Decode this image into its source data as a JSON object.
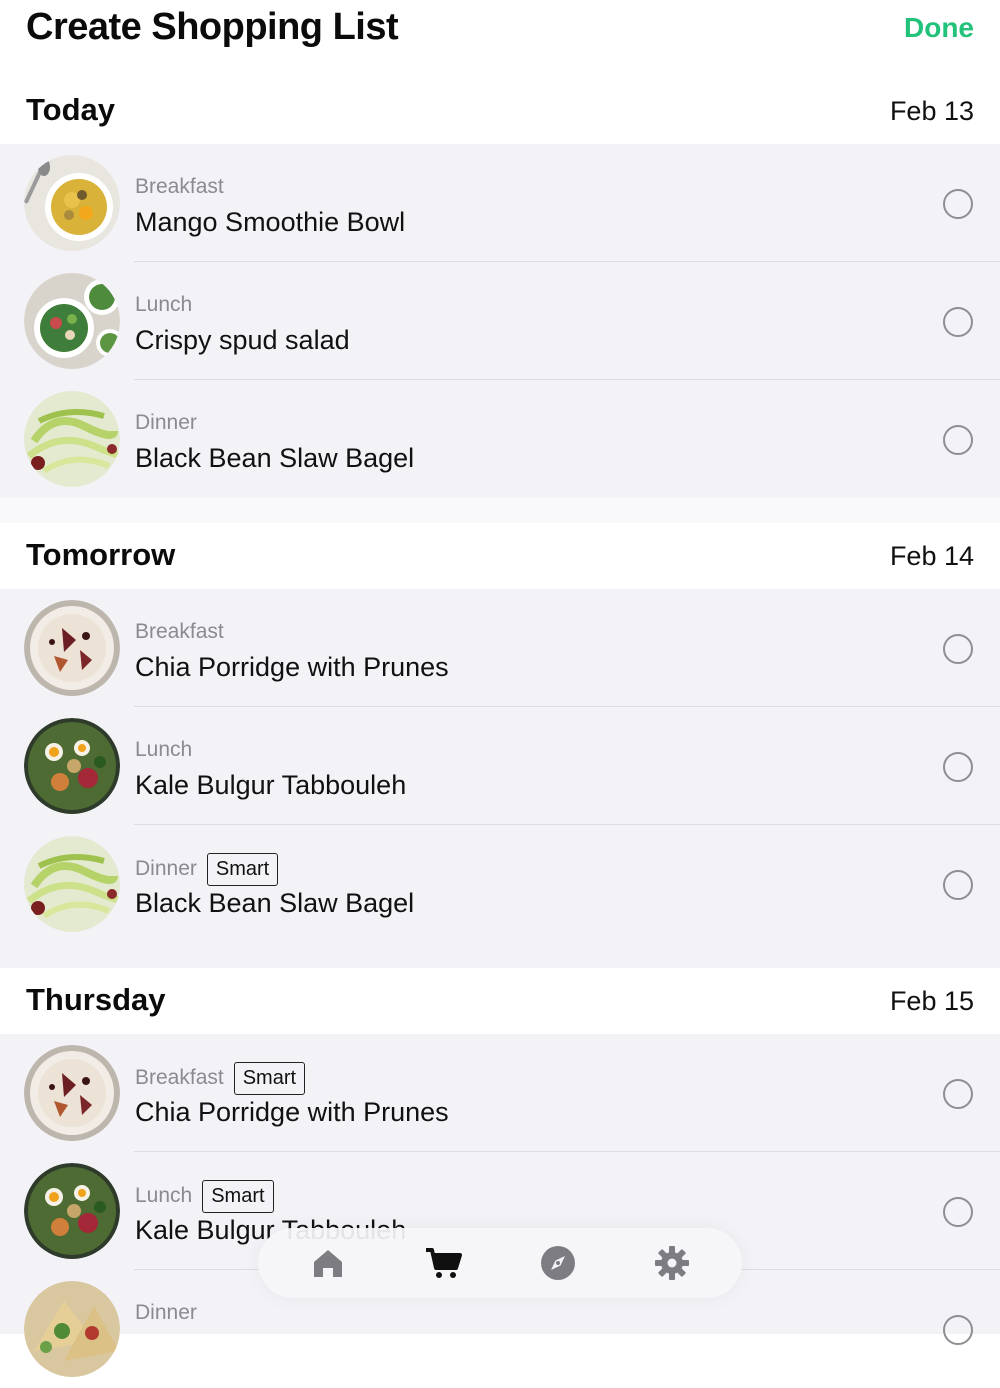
{
  "header": {
    "title": "Create Shopping List",
    "done_label": "Done"
  },
  "accent_color": "#22c27a",
  "sections": [
    {
      "day": "Today",
      "date": "Feb 13",
      "meals": [
        {
          "meal": "Breakfast",
          "badge": "",
          "dish": "Mango Smoothie Bowl",
          "image": "mango-smoothie-bowl"
        },
        {
          "meal": "Lunch",
          "badge": "",
          "dish": "Crispy spud salad",
          "image": "crispy-spud-salad"
        },
        {
          "meal": "Dinner",
          "badge": "",
          "dish": "Black Bean Slaw Bagel",
          "image": "black-bean-slaw-bagel"
        }
      ]
    },
    {
      "day": "Tomorrow",
      "date": "Feb 14",
      "meals": [
        {
          "meal": "Breakfast",
          "badge": "",
          "dish": "Chia Porridge with Prunes",
          "image": "chia-porridge"
        },
        {
          "meal": "Lunch",
          "badge": "",
          "dish": "Kale Bulgur Tabbouleh",
          "image": "kale-bulgur-tabbouleh"
        },
        {
          "meal": "Dinner",
          "badge": "Smart",
          "dish": "Black Bean Slaw Bagel",
          "image": "black-bean-slaw-bagel"
        }
      ]
    },
    {
      "day": "Thursday",
      "date": "Feb 15",
      "meals": [
        {
          "meal": "Breakfast",
          "badge": "Smart",
          "dish": "Chia Porridge with Prunes",
          "image": "chia-porridge"
        },
        {
          "meal": "Lunch",
          "badge": "Smart",
          "dish": "Kale Bulgur Tabbouleh",
          "image": "kale-bulgur-tabbouleh"
        },
        {
          "meal": "Dinner",
          "badge": "",
          "dish": "",
          "image": "wrap"
        }
      ]
    }
  ],
  "tabbar": {
    "tabs": [
      {
        "icon": "home-icon",
        "active": false
      },
      {
        "icon": "cart-icon",
        "active": true
      },
      {
        "icon": "compass-icon",
        "active": false
      },
      {
        "icon": "gear-icon",
        "active": false
      }
    ]
  }
}
